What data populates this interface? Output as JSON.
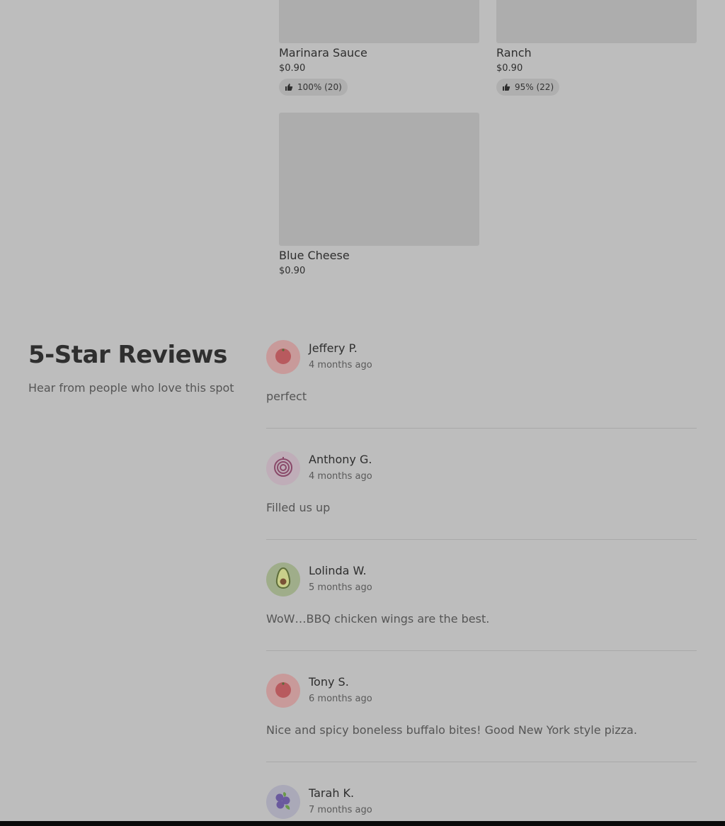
{
  "menu_items": [
    {
      "name": "Marinara Sauce",
      "price": "$0.90",
      "rating": "100% (20)"
    },
    {
      "name": "Ranch",
      "price": "$0.90",
      "rating": "95% (22)"
    },
    {
      "name": "Blue Cheese",
      "price": "$0.90"
    }
  ],
  "reviews_section": {
    "title": "5-Star Reviews",
    "subtitle": "Hear from people who love this spot",
    "reviews": [
      {
        "name": "Jeffery P.",
        "time": "4 months ago",
        "text": "perfect",
        "avatar_icon": "tomato-icon",
        "avatar_bg": "#c89a9a"
      },
      {
        "name": "Anthony G.",
        "time": "4 months ago",
        "text": "Filled us up",
        "avatar_icon": "onion-icon",
        "avatar_bg": "#bfadb8"
      },
      {
        "name": "Lolinda W.",
        "time": "5 months ago",
        "text": "WoW…BBQ chicken wings are the best.",
        "avatar_icon": "avocado-icon",
        "avatar_bg": "#9fad8a"
      },
      {
        "name": "Tony S.",
        "time": "6 months ago",
        "text": "Nice and spicy boneless buffalo bites! Good New York style pizza.",
        "avatar_icon": "tomato-icon",
        "avatar_bg": "#c89a9a"
      },
      {
        "name": "Tarah K.",
        "time": "7 months ago",
        "avatar_icon": "blueberry-icon",
        "avatar_bg": "#aaa9b8"
      }
    ]
  },
  "colors": {
    "overlay_bg": "#bdbdbd",
    "image_placeholder": "#adadad"
  }
}
